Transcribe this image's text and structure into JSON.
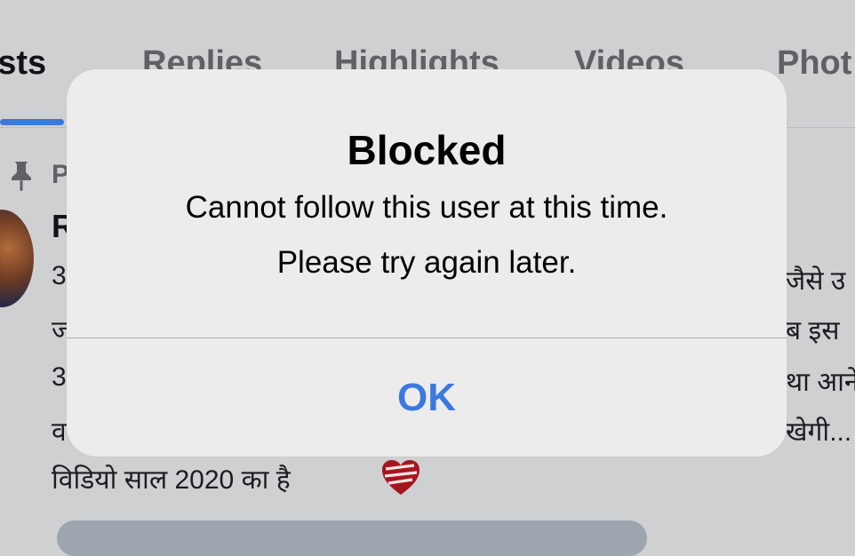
{
  "tabs": [
    {
      "label": "Posts",
      "visible_text": "osts",
      "active": true
    },
    {
      "label": "Replies",
      "active": false
    },
    {
      "label": "Highlights",
      "active": false
    },
    {
      "label": "Videos",
      "active": false
    },
    {
      "label": "Phot",
      "active": false
    }
  ],
  "post": {
    "pinned_label": "P",
    "author_initial": "R",
    "lines": [
      {
        "left": "3",
        "right": "जैसे उ"
      },
      {
        "left": "ज",
        "right": "ब इस"
      },
      {
        "left": "3",
        "right": "था आने"
      },
      {
        "left": "व",
        "right": "खेगी..."
      }
    ],
    "last_line": "विडियो साल 2020 का है"
  },
  "dialog": {
    "title": "Blocked",
    "message_line1": "Cannot follow this user at this time.",
    "message_line2": "Please try again later.",
    "ok_label": "OK"
  },
  "colors": {
    "accent": "#3b78e0",
    "tab_underline": "#3a7bd5",
    "dialog_bg": "#ececec",
    "page_bg": "#cfd0d1"
  },
  "icons": [
    "pin-icon",
    "avatar",
    "heart-emoji-icon"
  ]
}
